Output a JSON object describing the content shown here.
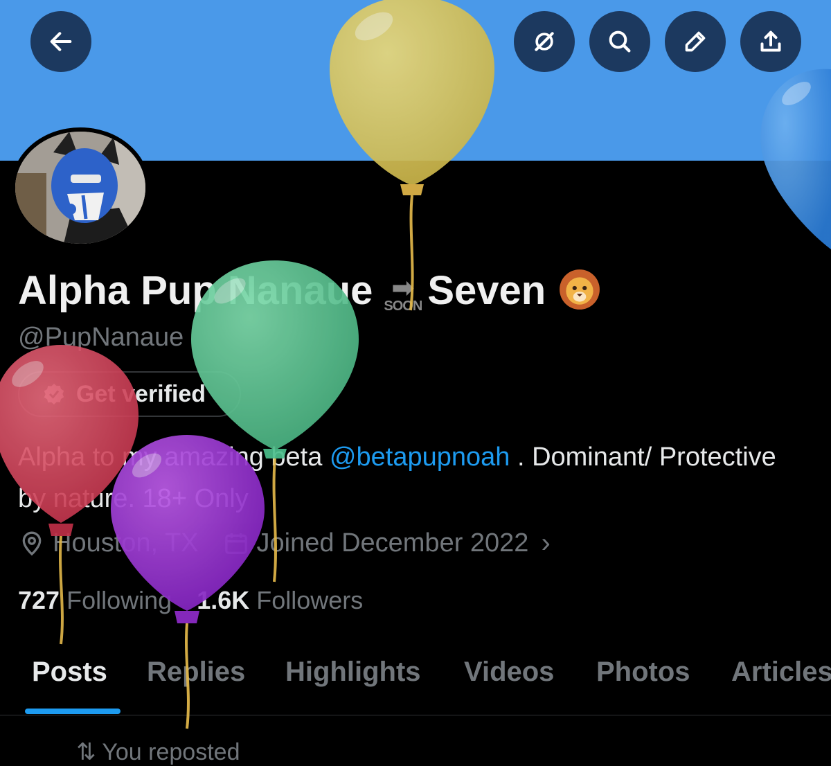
{
  "header": {
    "back_icon": "arrow-left-icon",
    "actions": [
      "grok-icon",
      "search-icon",
      "pencil-icon",
      "share-icon"
    ]
  },
  "profile": {
    "display_name_part1": "Alpha Pup Nanaue",
    "soon_label": "SOON",
    "display_name_part2": "Seven",
    "name_emoji": "lion-face-emoji",
    "handle": "@PupNanaue",
    "verify_button": "Get verified",
    "bio_before": "Alpha to my amazing beta ",
    "bio_mention": "@betapupnoah",
    "bio_after": " . Dominant/ Protective by nature. 18+ Only",
    "location": "Houston, TX",
    "joined": "Joined December 2022",
    "following_count": "727",
    "following_label": "Following",
    "followers_count": "1.6K",
    "followers_label": "Followers"
  },
  "tabs": [
    "Posts",
    "Replies",
    "Highlights",
    "Videos",
    "Photos",
    "Articles"
  ],
  "active_tab": "Posts",
  "colors": {
    "banner": "#4a99e9",
    "accent": "#1d9bf0",
    "background": "#000000",
    "balloon_yellow": "#d8c455",
    "balloon_green": "#5fcb97",
    "balloon_red": "#d84a5e",
    "balloon_purple": "#9a33d0",
    "balloon_blue": "#3c8ee3"
  },
  "next_row_text": "You reposted"
}
